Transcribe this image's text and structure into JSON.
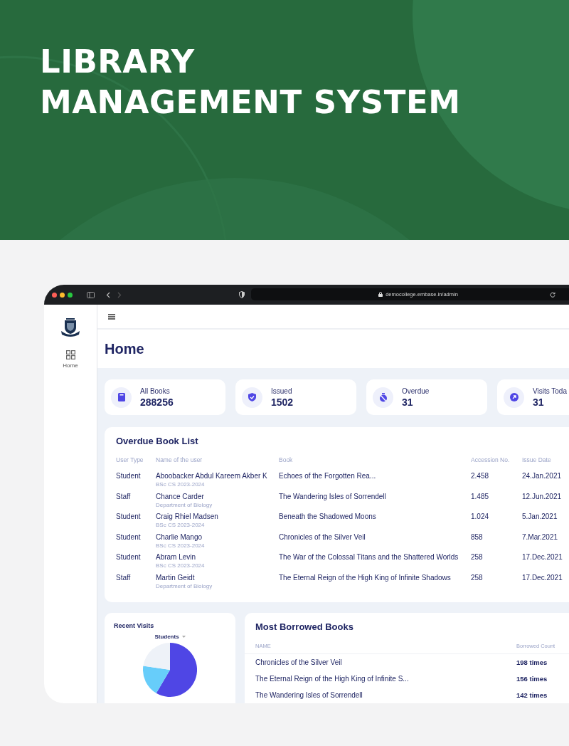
{
  "banner": {
    "title_lines": [
      "LIBRARY",
      "MANAGEMENT SYSTEM"
    ]
  },
  "browser": {
    "url": "democollege.embase.in/admin"
  },
  "sidebar": {
    "items": [
      {
        "label": "Home"
      }
    ]
  },
  "page_title": "Home",
  "stats": [
    {
      "label": "All Books",
      "value": "288256",
      "kind": "book"
    },
    {
      "label": "Issued",
      "value": "1502",
      "kind": "shield"
    },
    {
      "label": "Overdue",
      "value": "31",
      "kind": "timer"
    },
    {
      "label": "Visits Toda",
      "value": "31",
      "kind": "arrow"
    }
  ],
  "overdue_list": {
    "title": "Overdue Book List",
    "columns": [
      "User Type",
      "Name of the user",
      "Book",
      "Accession No.",
      "Issue Date"
    ],
    "rows": [
      {
        "user_type": "Student",
        "name": "Aboobacker Abdul Kareem Akber K",
        "detail": "BSc CS 2023-2024",
        "book": "Echoes of the Forgotten Rea...",
        "accession": "2.458",
        "issue_date": "24.Jan.2021"
      },
      {
        "user_type": "Staff",
        "name": "Chance Carder",
        "detail": "Department of Biology",
        "book": "The Wandering Isles of Sorrendell",
        "accession": "1.485",
        "issue_date": "12.Jun.2021"
      },
      {
        "user_type": "Student",
        "name": "Craig Rhiel Madsen",
        "detail": "BSc CS 2023-2024",
        "book": "Beneath the Shadowed Moons",
        "accession": "1.024",
        "issue_date": "5.Jan.2021"
      },
      {
        "user_type": "Student",
        "name": "Charlie Mango",
        "detail": "BSc CS 2023-2024",
        "book": "Chronicles of the Silver Veil",
        "accession": "858",
        "issue_date": "7.Mar.2021"
      },
      {
        "user_type": "Student",
        "name": "Abram Levin",
        "detail": "BSc CS 2023-2024",
        "book": "The War of the Colossal Titans and the Shattered Worlds",
        "accession": "258",
        "issue_date": "17.Dec.2021"
      },
      {
        "user_type": "Staff",
        "name": "Martin Geidt",
        "detail": "Department of Biology",
        "book": "The Eternal Reign of the High King of Infinite Shadows",
        "accession": "258",
        "issue_date": "17.Dec.2021"
      }
    ]
  },
  "recent_visits": {
    "title": "Recent Visits",
    "filter": "Students"
  },
  "most_borrowed": {
    "title": "Most Borrowed Books",
    "columns": [
      "NAME",
      "Borrowed Count"
    ],
    "rows": [
      {
        "name": "Chronicles of the Silver Veil",
        "count": "198 times"
      },
      {
        "name": "The Eternal Reign of the High King of Infinite S...",
        "count": "156 times"
      },
      {
        "name": "The Wandering Isles of Sorrendell",
        "count": "142 times"
      }
    ]
  }
}
